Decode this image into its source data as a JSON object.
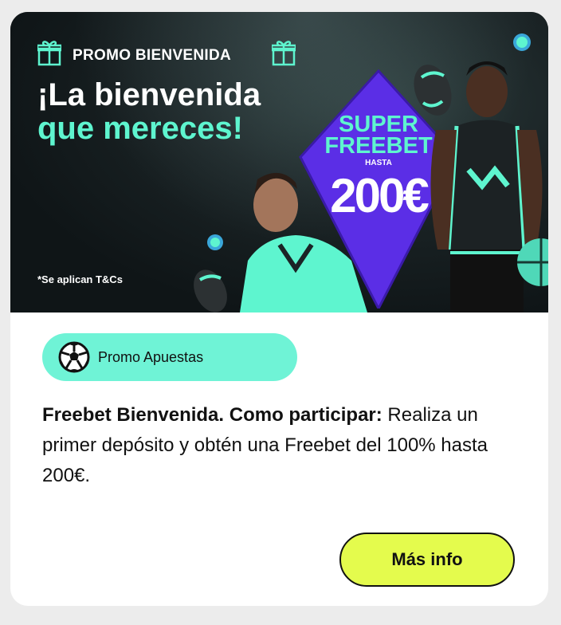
{
  "banner": {
    "kicker": "PROMO BIENVENIDA",
    "headline_line1": "¡La bienvenida",
    "headline_line2": "que mereces!",
    "super_line1": "SUPER",
    "super_line2": "FREEBET",
    "hasta": "HASTA",
    "amount": "200€",
    "terms": "*Se aplican T&Cs",
    "colors": {
      "accent": "#5ef5cf",
      "diamond": "#5b2ee6",
      "dark": "#111a1c"
    }
  },
  "badge": {
    "icon": "soccer-ball-icon",
    "label": "Promo Apuestas",
    "color": "#6ff3d6"
  },
  "description": {
    "bold": "Freebet Bienvenida. Como participar:",
    "text": " Realiza un primer depósito y obtén una Freebet del 100% hasta 200€."
  },
  "cta": {
    "label": "Más info",
    "color": "#e4fb4d"
  }
}
